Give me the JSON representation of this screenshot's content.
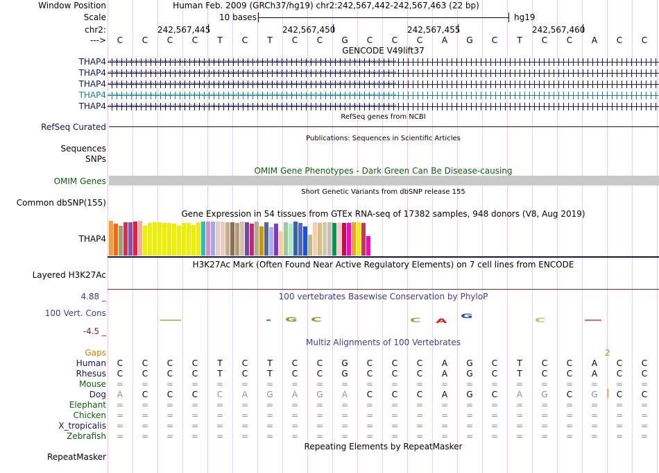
{
  "header": {
    "window_position_label": "Window Position",
    "assembly_text": "Human Feb. 2009 (GRCh37/hg19)   chr2:242,567,442-242,567,463 (22 bp)",
    "scale_label": "Scale",
    "scale_text": "10 bases",
    "scale_db": "hg19",
    "chrom_label": "chr2:",
    "coords": [
      "242,567,445",
      "242,567,450",
      "242,567,455",
      "242,567,460"
    ],
    "strand_label": "--->"
  },
  "reference_bases": [
    "C",
    "C",
    "C",
    "C",
    "T",
    "C",
    "T",
    "C",
    "C",
    "G",
    "C",
    "C",
    "C",
    "A",
    "G",
    "C",
    "T",
    "C",
    "C",
    "A",
    "C",
    "C"
  ],
  "gencode": {
    "title": "GENCODE V49lift37",
    "tracks": [
      {
        "label": "THAP4",
        "color": "#12125e"
      },
      {
        "label": "THAP4",
        "color": "#12125e"
      },
      {
        "label": "THAP4",
        "color": "#12125e"
      },
      {
        "label": "THAP4",
        "color": "#1a7f8e"
      },
      {
        "label": "THAP4",
        "color": "#12125e"
      }
    ]
  },
  "refseq": {
    "title": "RefSeq genes from NCBI",
    "label": "RefSeq Curated",
    "color": "#12125e"
  },
  "publications": {
    "title": "Publications: Sequences in Scientific Articles",
    "seq_label": "Sequences",
    "snp_label": "SNPs"
  },
  "omim": {
    "title": "OMIM Gene Phenotypes - Dark Green Can Be Disease-causing",
    "label": "OMIM Genes",
    "color": "#0b5e0b",
    "bar_color": "#c8c8c8"
  },
  "dbsnp": {
    "title": "Short Genetic Variants from dbSNP release 155",
    "label": "Common dbSNP(155)"
  },
  "gtex": {
    "title": "Gene Expression in 54 tissues from GTEx RNA-seq of 17382 samples, 948 donors (V8, Aug 2019)",
    "label": "THAP4",
    "line_color": "#12125e",
    "bar_levels": [
      1.0,
      0.92,
      0.85,
      0.95,
      0.95,
      0.98,
      1.0,
      0.85,
      0.93,
      0.95,
      0.95,
      0.93,
      0.93,
      0.91,
      0.85,
      0.93,
      0.93,
      0.88,
      0.95,
      0.97,
      0.98,
      0.98,
      0.98,
      0.98,
      0.95,
      0.95,
      0.93,
      0.98,
      0.95,
      0.92,
      0.97,
      0.83,
      0.95,
      0.82,
      0.92,
      0.7,
      0.95,
      0.92,
      0.98,
      0.93,
      0.83,
      0.6,
      0.95,
      0.93,
      0.95,
      0.95,
      0.93,
      0.93,
      0.93,
      0.93,
      0.95,
      0.95,
      0.93,
      0.57
    ],
    "bar_colors": [
      "#ff9933",
      "#ff6600",
      "#a0a36b",
      "#cc3355",
      "#8e4fb0",
      "#dd2244",
      "#ffaa99",
      "#eeee00",
      "#eeee00",
      "#eeee00",
      "#eeee00",
      "#eeee00",
      "#eeee00",
      "#eeee00",
      "#eeee00",
      "#eeee00",
      "#eeee00",
      "#eeee00",
      "#eeee00",
      "#22c1c1",
      "#dd88cc",
      "#99aaee",
      "#e8cbc6",
      "#e8cbc6",
      "#ccaa88",
      "#8b6f55",
      "#bb9977",
      "#d0c1a8",
      "#7744aa",
      "#cc2277",
      "#b8a890",
      "#cc9900",
      "#556699",
      "#aaaaff",
      "#8833cc",
      "#ffcc99",
      "#99cc99",
      "#aaeebb",
      "#3366aa",
      "#5566cc",
      "#1155ee",
      "#bbbb88",
      "#ffccaa",
      "#ddbb88",
      "#ccccaa",
      "#ccbbbb",
      "#009944",
      "#eecccc",
      "#dd0044",
      "#ff00cc",
      "#ff9933",
      "#eeee00",
      "#cc3355",
      "#ff00cc"
    ]
  },
  "h3k27ac": {
    "title": "H3K27Ac Mark (Often Found Near Active Regulatory Elements) on 7 cell lines from ENCODE",
    "label": "Layered H3K27Ac",
    "line_color": "#8b1a1a"
  },
  "phylop": {
    "title": "100 vertebrates Basewise Conservation by PhyloP",
    "label": "100 Vert. Cons",
    "ymax": "4.88 _",
    "ymin": "-4.5 _",
    "color": "#3b3b9c",
    "min_color": "#8b1a1a"
  },
  "multiz": {
    "title": "Multiz Alignments of 100 Vertebrates",
    "gaps_label": "Gaps",
    "gaps_value": "2",
    "gaps_color": "#e08000",
    "species": [
      {
        "label": "Human",
        "color": "#12125e",
        "bases": [
          "C",
          "C",
          "C",
          "C",
          "T",
          "C",
          "T",
          "C",
          "C",
          "G",
          "C",
          "C",
          "C",
          "A",
          "G",
          "C",
          "T",
          "C",
          "C",
          "A",
          "C",
          "C"
        ]
      },
      {
        "label": "Rhesus",
        "color": "#12125e",
        "bases": [
          "C",
          "C",
          "C",
          "C",
          "T",
          "C",
          "T",
          "C",
          "C",
          "G",
          "C",
          "C",
          "C",
          "A",
          "G",
          "C",
          "T",
          "C",
          "C",
          "A",
          "C",
          "C"
        ]
      },
      {
        "label": "Mouse",
        "color": "#0b5e0b",
        "bases": [
          "=",
          "=",
          "=",
          "=",
          "=",
          "=",
          "=",
          "=",
          "=",
          "=",
          "=",
          "=",
          "=",
          "=",
          "=",
          "=",
          "=",
          "=",
          "=",
          "=",
          "=",
          "="
        ]
      },
      {
        "label": "Dog",
        "color": "#12125e",
        "bases": [
          "A",
          "C",
          "C",
          "C",
          "C",
          "A",
          "G",
          "A",
          "G",
          "A",
          "C",
          "C",
          "C",
          "A",
          "G",
          "C",
          "A",
          "G",
          "C",
          "G",
          "C",
          "C"
        ]
      },
      {
        "label": "Elephant",
        "color": "#0b5e0b",
        "bases": [
          "=",
          "=",
          "=",
          "=",
          "=",
          "=",
          "=",
          "=",
          "=",
          "=",
          "=",
          "=",
          "=",
          "=",
          "=",
          "=",
          "=",
          "=",
          "=",
          "=",
          "=",
          "="
        ]
      },
      {
        "label": "Chicken",
        "color": "#0b5e0b",
        "bases": [
          "=",
          "=",
          "=",
          "=",
          "=",
          "=",
          "=",
          "=",
          "=",
          "=",
          "=",
          "=",
          "=",
          "=",
          "=",
          "=",
          "=",
          "=",
          "=",
          "=",
          "=",
          "="
        ]
      },
      {
        "label": "X_tropicalis",
        "color": "#12125e",
        "bases": [
          "=",
          "=",
          "=",
          "=",
          "=",
          "=",
          "=",
          "=",
          "=",
          "=",
          "=",
          "=",
          "=",
          "=",
          "=",
          "=",
          "=",
          "=",
          "=",
          "=",
          "=",
          "="
        ]
      },
      {
        "label": "Zebrafish",
        "color": "#0b5e0b",
        "bases": [
          "=",
          "=",
          "=",
          "=",
          "=",
          "=",
          "=",
          "=",
          "=",
          "=",
          "=",
          "=",
          "=",
          "=",
          "=",
          "=",
          "=",
          "=",
          "=",
          "=",
          "=",
          "="
        ]
      }
    ]
  },
  "repeatmasker": {
    "title": "Repeating Elements by RepeatMasker",
    "label": "RepeatMasker"
  }
}
